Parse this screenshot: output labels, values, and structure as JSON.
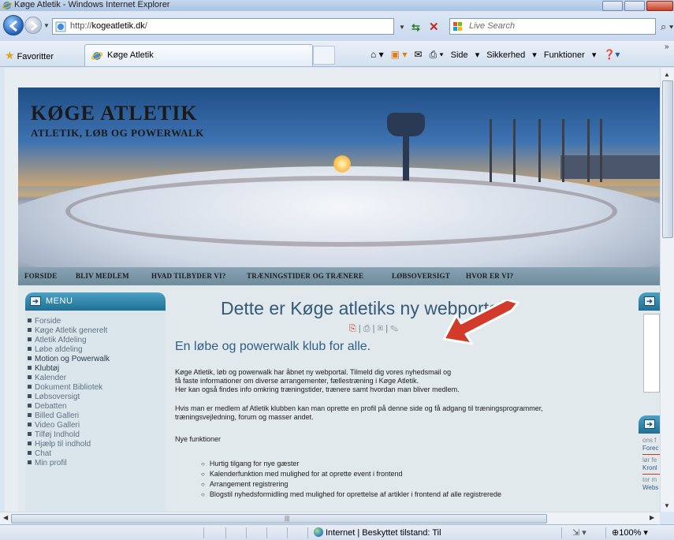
{
  "window": {
    "title": "Køge Atletik - Windows Internet Explorer"
  },
  "address_bar": {
    "url_prefix": "http://",
    "url_host": "kogeatletik.dk",
    "url_suffix": "/"
  },
  "search": {
    "placeholder": "Live Search"
  },
  "favorites": {
    "label": "Favoritter"
  },
  "tab": {
    "label": "Køge Atletik"
  },
  "command_bar": {
    "page_label": "Side",
    "security_label": "Sikkerhed",
    "tools_label": "Funktioner"
  },
  "status": {
    "zone_text": "Internet | Beskyttet tilstand: Til",
    "zoom": "100%"
  },
  "site": {
    "logo_title": "KØGE ATLETIK",
    "logo_subtitle": "ATLETIK, LØB OG POWERWALK",
    "nav": [
      "FORSIDE",
      "BLIV MEDLEM",
      "HVAD TILBYDER VI?",
      "TRÆNINGSTIDER OG TRÆNERE",
      "LØBSOVERSIGT",
      "HVOR ER VI?"
    ],
    "menu_title": "MENU",
    "menu_items": [
      "Forside",
      "Køge Atletik generelt",
      "Atletik Afdeling",
      "Løbe afdeling",
      "Motion og Powerwalk",
      "Klubtøj",
      "Kalender",
      "Dokument Bibliotek",
      "Løbsoversigt",
      "Debatten",
      "Billed Galleri",
      "Video Galleri",
      "Tilføj Indhold",
      "Hjælp til indhold",
      "Chat",
      "Min profil"
    ],
    "main_title": "Dette er Køge atletiks ny webportal",
    "subtitle": "En løbe og powerwalk klub for alle.",
    "para1_line1": "Køge Atletik, løb og powerwalk har åbnet ny webportal. Tilmeld dig vores nyhedsmail og",
    "para1_line2": "få faste informationer om diverse arrangementer, fællestræning i Køge Atletik.",
    "para1_line3": "Her kan også findes info omkring træningstider, trænere samt hvordan man bliver medlem.",
    "para2_line1": "Hvis man er medlem af Atletik klubben kan man oprette en profil på denne side og få adgang til træningsprogrammer,",
    "para2_line2": "træningsvejledning, forum og masser andet.",
    "new_features": "Nye funktioner",
    "bullets": [
      "Hurtig tilgang for nye gæster",
      "Kalenderfunktion med mulighed for at oprette event i frontend",
      "Arrangement registrering",
      "Blogstil nyhedsformidling med mulighed for oprettelse af artikler i frontend af alle registrerede"
    ],
    "right_news": [
      "ons f",
      "Forec",
      "lør fe",
      "Kronl",
      "tor m",
      "Webs"
    ]
  },
  "colors": {
    "accent_blue": "#216e94",
    "nav_bg": "#7893a3",
    "title_color": "#355a78",
    "arrow_red": "#d23a2a"
  }
}
